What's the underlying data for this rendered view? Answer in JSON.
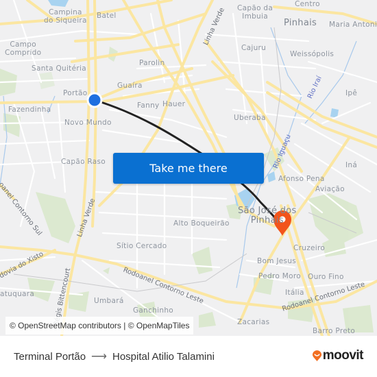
{
  "map": {
    "neighborhoods": [
      {
        "name": "Campina do Siqueira",
        "lines": [
          "Campina",
          "do Siqueira"
        ]
      },
      {
        "name": "Batel"
      },
      {
        "name": "Campo Comprido",
        "lines": [
          "Campo",
          "Comprido"
        ]
      },
      {
        "name": "Santa Quitéria"
      },
      {
        "name": "Parolin"
      },
      {
        "name": "Guaíra"
      },
      {
        "name": "Portão"
      },
      {
        "name": "Fanny"
      },
      {
        "name": "Hauer"
      },
      {
        "name": "Fazendinha"
      },
      {
        "name": "Novo Mundo"
      },
      {
        "name": "Capão Raso"
      },
      {
        "name": "Capão da Imbuia",
        "lines": [
          "Capão da",
          "Imbuia"
        ]
      },
      {
        "name": "Centro"
      },
      {
        "name": "Pinhais"
      },
      {
        "name": "Maria Antoni"
      },
      {
        "name": "Cajuru"
      },
      {
        "name": "Weissópolis"
      },
      {
        "name": "Ipê"
      },
      {
        "name": "Uberaba"
      },
      {
        "name": "Iná"
      },
      {
        "name": "Afonso Pena"
      },
      {
        "name": "Aviação"
      },
      {
        "name": "São José dos Pinhais",
        "lines": [
          "São José dos",
          "Pinhais"
        ]
      },
      {
        "name": "Alto Boqueirão"
      },
      {
        "name": "Sítio Cercado"
      },
      {
        "name": "Cruzeiro"
      },
      {
        "name": "Bom Jesus"
      },
      {
        "name": "Pedro Moro"
      },
      {
        "name": "Ouro Fino"
      },
      {
        "name": "Itália"
      },
      {
        "name": "Umbará"
      },
      {
        "name": "Ganchinho"
      },
      {
        "name": "Zacarias"
      },
      {
        "name": "Barro Preto"
      },
      {
        "name": "Caxuquara",
        "display": "atuquara"
      }
    ],
    "roads": [
      {
        "name": "Linha Verde"
      },
      {
        "name": "Linha Verde (south)",
        "display": "Linha Verde"
      },
      {
        "name": "Rodoanel Contorno Sul",
        "display": "oanel Contorno Sul"
      },
      {
        "name": "Rodovia do Xisto",
        "display": "dovia do Xisto"
      },
      {
        "name": "Régis Bittencourt",
        "display": "Régis Bittencourt"
      },
      {
        "name": "Rodoanel Contorno Leste",
        "display": "Rodoanel Contorno Leste"
      },
      {
        "name": "Rodoanel Contorno Leste (east)",
        "display": "Rodoanel Contorno Leste"
      }
    ],
    "rivers": [
      {
        "name": "Rio Iraí"
      },
      {
        "name": "Rio Iguaçu"
      }
    ],
    "origin_marker": {
      "label": "Terminal Portão",
      "color": "#1e6fe0"
    },
    "destination_marker": {
      "label": "Hospital Atilio Talamini",
      "color": "#f2541b"
    },
    "route_color": "#222222",
    "cta_label": "Take me there",
    "cta_color": "#0a70d1",
    "attribution": "© OpenStreetMap contributors | © OpenMapTiles"
  },
  "footer": {
    "from": "Terminal Portão",
    "arrow": "⟶",
    "to": "Hospital Atilio Talamini",
    "brand": "moovit",
    "brand_color": "#f26f21"
  }
}
